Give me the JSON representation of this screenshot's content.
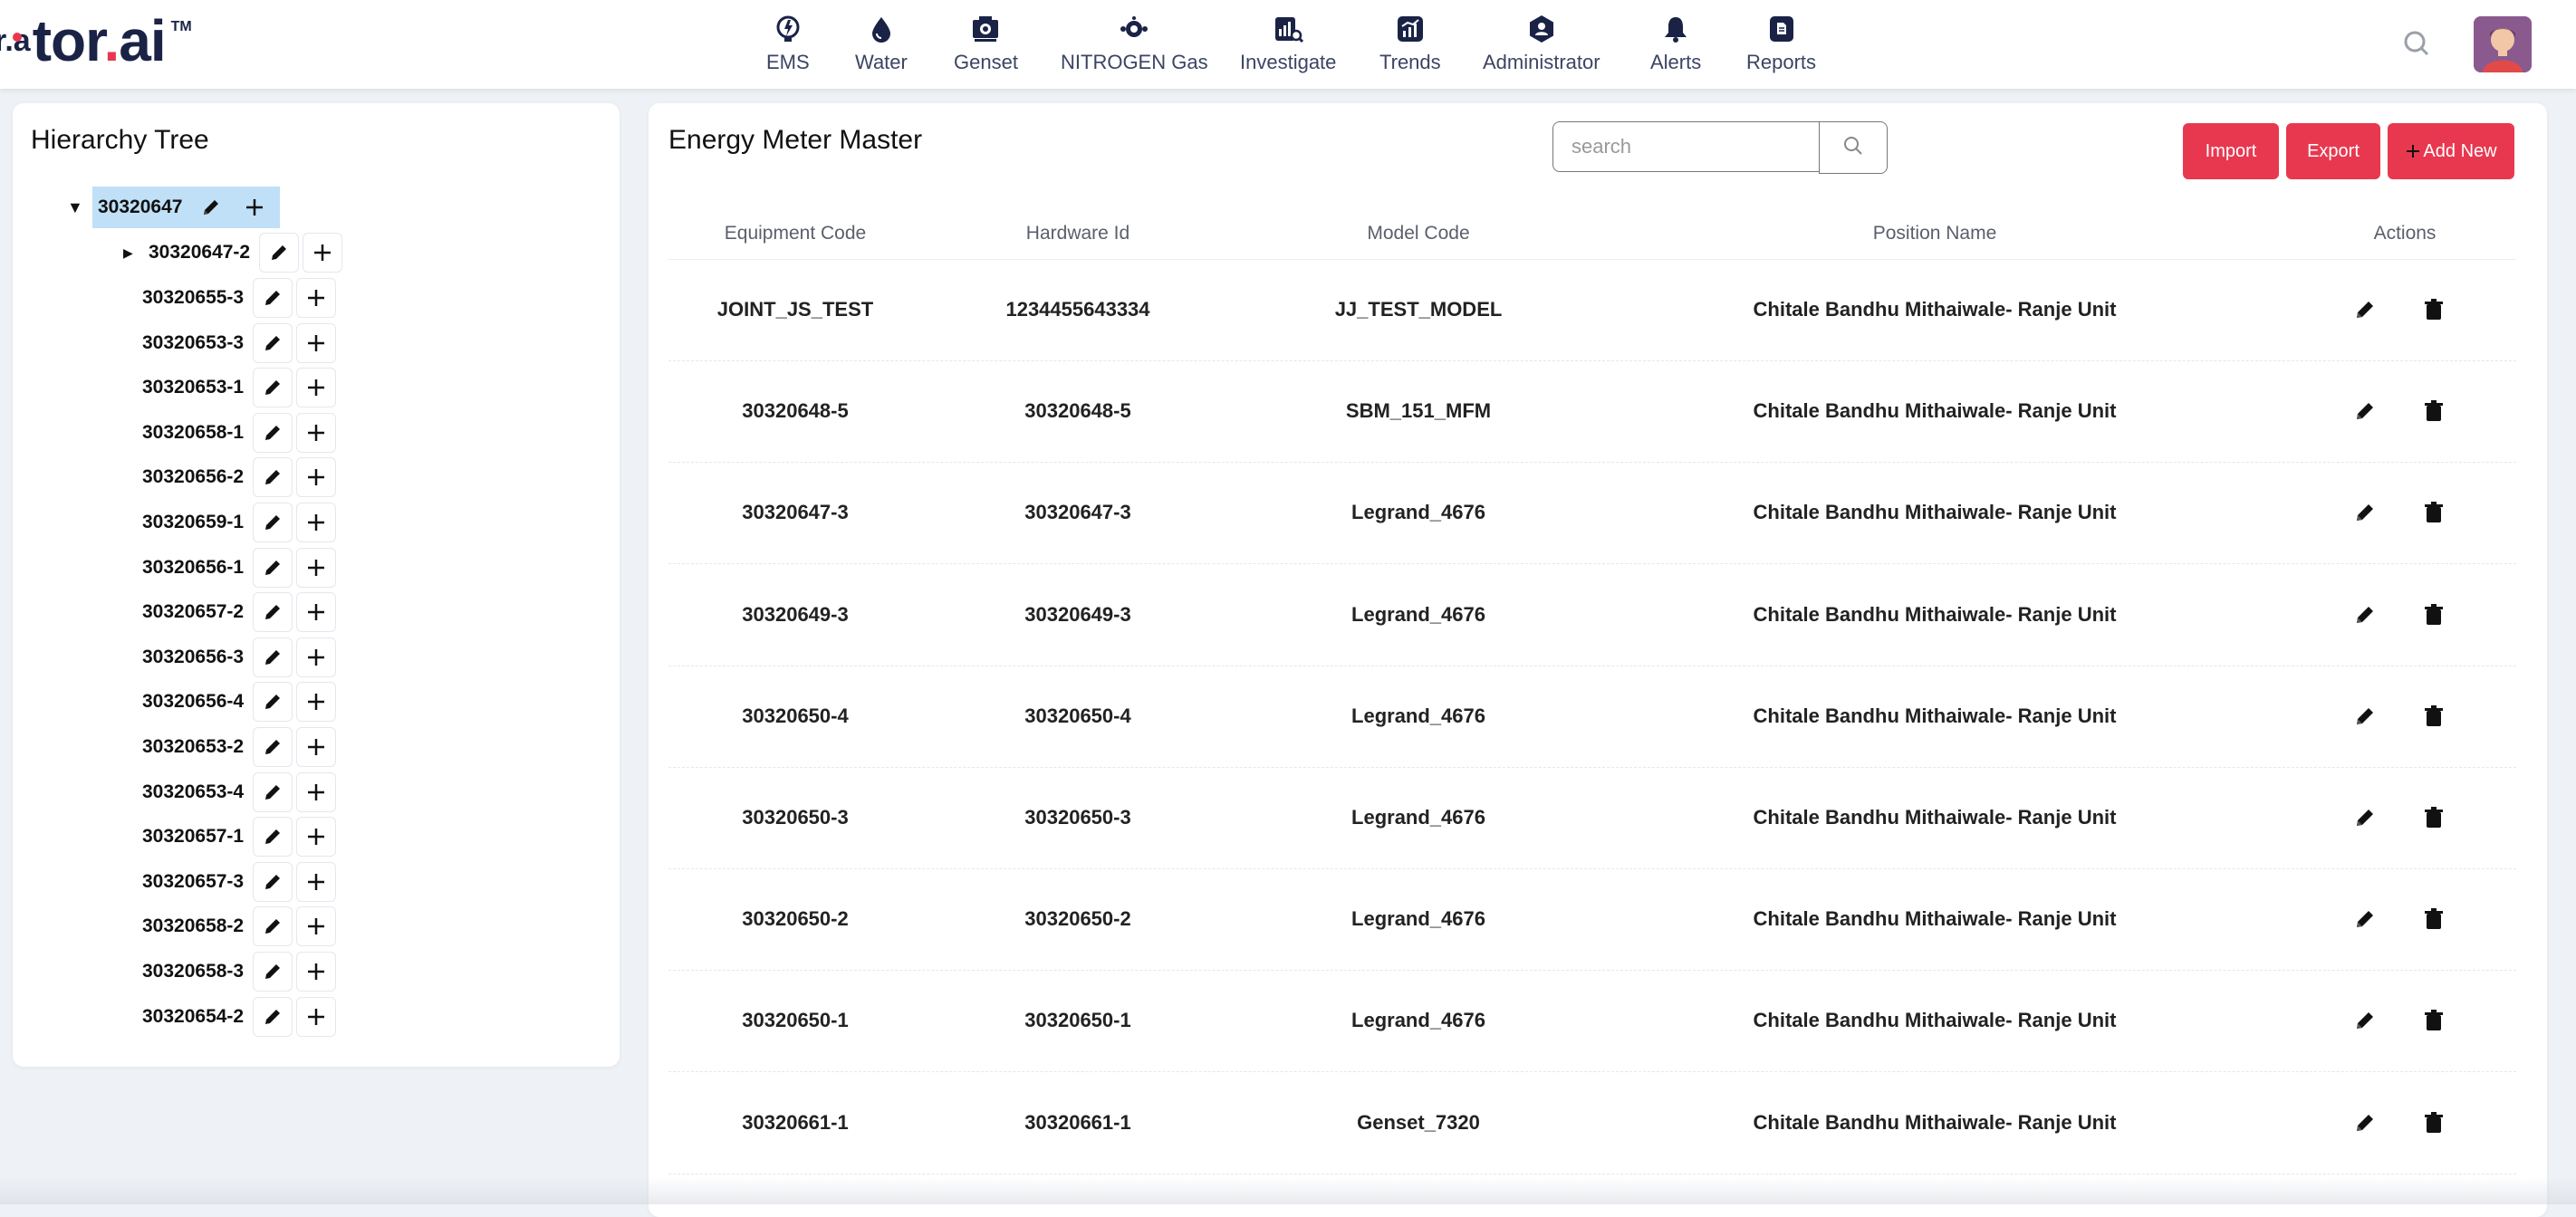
{
  "brand": {
    "prefix": "r.a",
    "name_main": "tor",
    "dot": ".",
    "name_end": "ai",
    "tm": "TM"
  },
  "nav": {
    "items": [
      {
        "label": "EMS",
        "icon": "lightbulb-icon"
      },
      {
        "label": "Water",
        "icon": "water-drop-icon"
      },
      {
        "label": "Genset",
        "icon": "genset-icon"
      },
      {
        "label": "NITROGEN Gas",
        "icon": "gas-icon"
      },
      {
        "label": "Investigate",
        "icon": "investigate-icon"
      },
      {
        "label": "Trends",
        "icon": "trends-icon"
      },
      {
        "label": "Administrator",
        "icon": "admin-icon"
      },
      {
        "label": "Alerts",
        "icon": "bell-icon"
      },
      {
        "label": "Reports",
        "icon": "reports-icon"
      }
    ]
  },
  "hierarchy": {
    "title": "Hierarchy Tree",
    "root": "30320647",
    "child_expandable": "30320647-2",
    "children": [
      "30320655-3",
      "30320653-3",
      "30320653-1",
      "30320658-1",
      "30320656-2",
      "30320659-1",
      "30320656-1",
      "30320657-2",
      "30320656-3",
      "30320656-4",
      "30320653-2",
      "30320653-4",
      "30320657-1",
      "30320657-3",
      "30320658-2",
      "30320658-3",
      "30320654-2"
    ]
  },
  "main": {
    "title": "Energy Meter Master",
    "search_placeholder": "search",
    "import_label": "Import",
    "export_label": "Export",
    "add_new_label": "Add New",
    "columns": [
      "Equipment Code",
      "Hardware Id",
      "Model Code",
      "Position Name",
      "Actions"
    ],
    "rows": [
      {
        "equipment_code": "JOINT_JS_TEST",
        "hardware_id": "1234455643334",
        "model_code": "JJ_TEST_MODEL",
        "position_name": "Chitale Bandhu Mithaiwale- Ranje Unit"
      },
      {
        "equipment_code": "30320648-5",
        "hardware_id": "30320648-5",
        "model_code": "SBM_151_MFM",
        "position_name": "Chitale Bandhu Mithaiwale- Ranje Unit"
      },
      {
        "equipment_code": "30320647-3",
        "hardware_id": "30320647-3",
        "model_code": "Legrand_4676",
        "position_name": "Chitale Bandhu Mithaiwale- Ranje Unit"
      },
      {
        "equipment_code": "30320649-3",
        "hardware_id": "30320649-3",
        "model_code": "Legrand_4676",
        "position_name": "Chitale Bandhu Mithaiwale- Ranje Unit"
      },
      {
        "equipment_code": "30320650-4",
        "hardware_id": "30320650-4",
        "model_code": "Legrand_4676",
        "position_name": "Chitale Bandhu Mithaiwale- Ranje Unit"
      },
      {
        "equipment_code": "30320650-3",
        "hardware_id": "30320650-3",
        "model_code": "Legrand_4676",
        "position_name": "Chitale Bandhu Mithaiwale- Ranje Unit"
      },
      {
        "equipment_code": "30320650-2",
        "hardware_id": "30320650-2",
        "model_code": "Legrand_4676",
        "position_name": "Chitale Bandhu Mithaiwale- Ranje Unit"
      },
      {
        "equipment_code": "30320650-1",
        "hardware_id": "30320650-1",
        "model_code": "Legrand_4676",
        "position_name": "Chitale Bandhu Mithaiwale- Ranje Unit"
      },
      {
        "equipment_code": "30320661-1",
        "hardware_id": "30320661-1",
        "model_code": "Genset_7320",
        "position_name": "Chitale Bandhu Mithaiwale- Ranje Unit"
      }
    ]
  },
  "colors": {
    "accent": "#e8384f",
    "nav_text": "#3b4463",
    "brand_navy": "#1a2346",
    "tree_selected_bg": "#bfe0f7"
  }
}
